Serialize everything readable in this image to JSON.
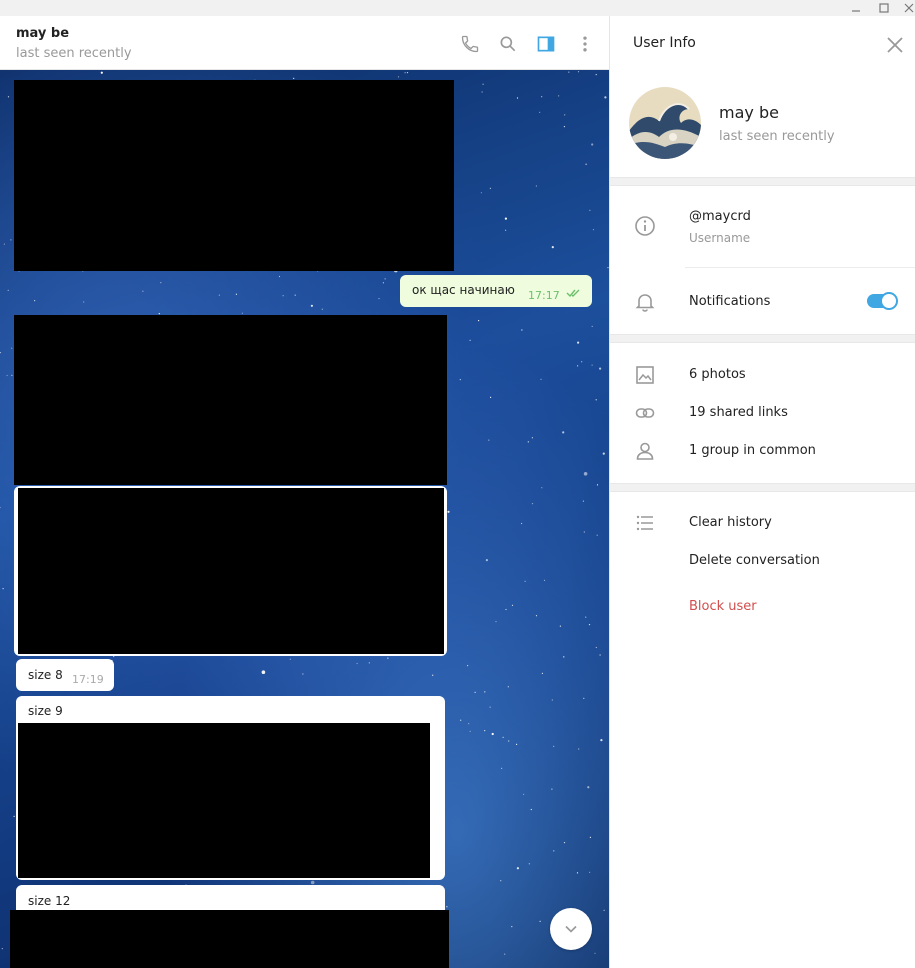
{
  "chat": {
    "title": "may be",
    "status": "last seen recently",
    "header_icons": [
      "phone-icon",
      "search-icon",
      "sidebar-toggle-icon",
      "more-vertical-icon"
    ]
  },
  "messages": {
    "outgoing_1": {
      "text": "ок щас начинаю",
      "time": "17:17"
    },
    "incoming_size8": {
      "text": "size 8",
      "time": "17:19"
    },
    "incoming_size9": {
      "text": "size 9"
    },
    "incoming_size12": {
      "text": "size 12"
    }
  },
  "panel": {
    "title": "User Info",
    "profile": {
      "name": "may be",
      "status": "last seen recently"
    },
    "username": {
      "value": "@maycrd",
      "label": "Username"
    },
    "notifications": {
      "label": "Notifications",
      "enabled": true
    },
    "media": {
      "photos": "6 photos",
      "links": "19 shared links",
      "groups": "1 group in common"
    },
    "actions": {
      "clear_history": "Clear history",
      "delete_conversation": "Delete conversation",
      "block_user": "Block user"
    }
  },
  "colors": {
    "accent": "#40a7e3",
    "danger": "#d14e4e",
    "outgoing_bubble": "#effdde",
    "time_outgoing": "#6dc06b"
  }
}
